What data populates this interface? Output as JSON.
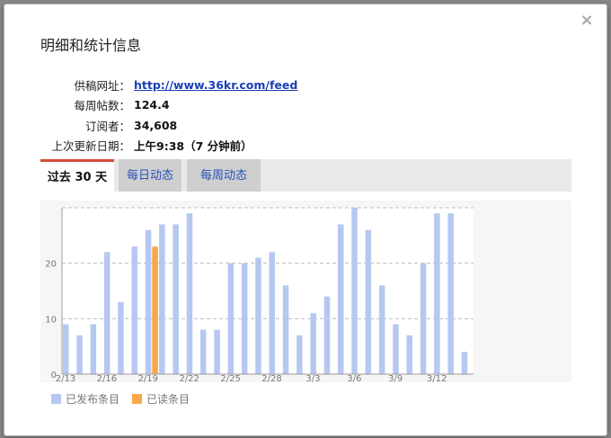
{
  "dialog": {
    "title": "明细和统计信息",
    "close_label": "×"
  },
  "info": {
    "feed_label": "供稿网址：",
    "feed_url": "http://www.36kr.com/feed",
    "posts_label": "每周帖数：",
    "posts_value": "124.4",
    "subs_label": "订阅者：",
    "subs_value": "34,608",
    "updated_label": "上次更新日期：",
    "updated_value": "上午9:38（7 分钟前）"
  },
  "tabs": [
    {
      "label": "过去 30 天",
      "active": true
    },
    {
      "label": "每日动态",
      "active": false
    },
    {
      "label": "每周动态",
      "active": false
    }
  ],
  "chart_data": {
    "type": "bar",
    "categories": [
      "2/13",
      "2/14",
      "2/15",
      "2/16",
      "2/17",
      "2/18",
      "2/19",
      "2/20",
      "2/21",
      "2/22",
      "2/23",
      "2/24",
      "2/25",
      "2/26",
      "2/27",
      "2/28",
      "3/1",
      "3/2",
      "3/3",
      "3/4",
      "3/5",
      "3/6",
      "3/7",
      "3/8",
      "3/9",
      "3/10",
      "3/11",
      "3/12",
      "3/13",
      "3/14"
    ],
    "x_tick_labels": [
      "2/13",
      "2/16",
      "2/19",
      "2/22",
      "2/25",
      "2/28",
      "3/3",
      "3/6",
      "3/9",
      "3/12"
    ],
    "series": [
      {
        "name": "已发布条目",
        "color": "#b6c8f0",
        "values": [
          9,
          7,
          9,
          22,
          13,
          23,
          26,
          27,
          27,
          29,
          8,
          8,
          20,
          20,
          21,
          22,
          16,
          7,
          11,
          14,
          27,
          30,
          26,
          16,
          9,
          7,
          20,
          29,
          29,
          4
        ]
      },
      {
        "name": "已读条目",
        "color": "#f9a74a",
        "values": [
          0,
          0,
          0,
          0,
          0,
          0,
          23,
          0,
          0,
          0,
          0,
          0,
          0,
          0,
          0,
          0,
          0,
          0,
          0,
          0,
          0,
          0,
          0,
          0,
          0,
          0,
          0,
          0,
          0,
          0
        ]
      }
    ],
    "y_ticks": [
      0,
      10,
      20
    ],
    "ylim": [
      0,
      30
    ],
    "grid": true,
    "legend_position": "bottom-left"
  }
}
